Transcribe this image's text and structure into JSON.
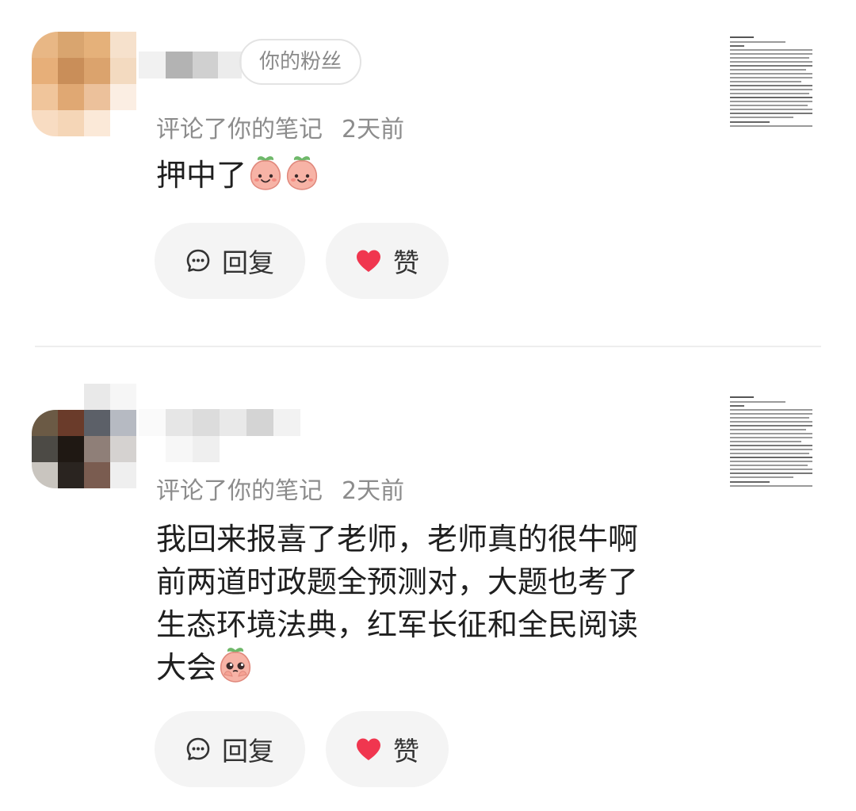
{
  "comments": [
    {
      "fan_badge": "你的粉丝",
      "action": "评论了你的笔记",
      "time": "2天前",
      "text": "押中了",
      "reply_label": "回复",
      "like_label": "赞"
    },
    {
      "action": "评论了你的笔记",
      "time": "2天前",
      "text_lines": [
        "我回来报喜了老师，老师真的很牛啊",
        "前两道时政题全预测对，大题也考了",
        "生态环境法典，红军长征和全民阅读",
        "大会"
      ],
      "reply_label": "回复",
      "like_label": "赞"
    }
  ],
  "colors": {
    "like_heart": "#f0364f",
    "button_bg": "#f4f4f4",
    "meta_text": "#8c8c8c"
  },
  "icons": [
    "comment-bubble-icon",
    "heart-icon",
    "peach-smile-emoji",
    "peach-pleading-emoji"
  ]
}
